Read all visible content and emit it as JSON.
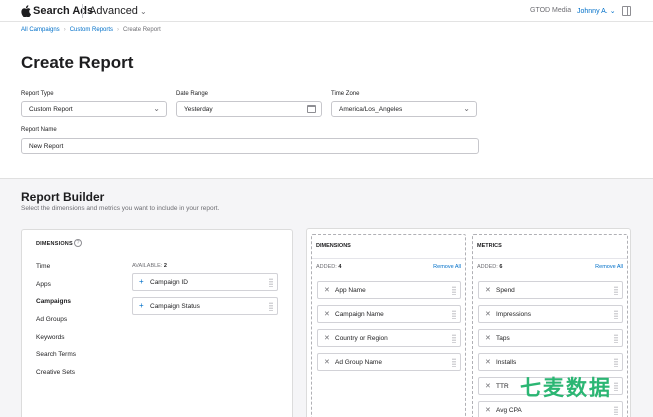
{
  "topbar": {
    "brand": "Search Ads",
    "product": "Advanced",
    "org": "GTOD Media",
    "user": "Johnny A."
  },
  "breadcrumb": [
    "All Campaigns",
    "Custom Reports",
    "Create Report"
  ],
  "page_title": "Create Report",
  "form": {
    "report_type": {
      "label": "Report Type",
      "value": "Custom Report"
    },
    "date_range": {
      "label": "Date Range",
      "value": "Yesterday"
    },
    "time_zone": {
      "label": "Time Zone",
      "value": "America/Los_Angeles"
    },
    "report_name": {
      "label": "Report Name",
      "value": "New Report"
    }
  },
  "builder": {
    "title": "Report Builder",
    "subtitle": "Select the dimensions and metrics you want to include in your report.",
    "dimensions_header": "DIMENSIONS",
    "categories": [
      "Time",
      "Apps",
      "Campaigns",
      "Ad Groups",
      "Keywords",
      "Search Terms",
      "Creative Sets"
    ],
    "active_category": "Campaigns",
    "available_label": "AVAILABLE:",
    "available_count": "2",
    "available": [
      "Campaign ID",
      "Campaign Status"
    ],
    "added_dimensions": {
      "title": "DIMENSIONS",
      "added_label": "ADDED:",
      "count": "4",
      "remove_all": "Remove All",
      "items": [
        "App Name",
        "Campaign Name",
        "Country or Region",
        "Ad Group Name"
      ]
    },
    "added_metrics": {
      "title": "METRICS",
      "added_label": "ADDED:",
      "count": "6",
      "remove_all": "Remove All",
      "items": [
        "Spend",
        "Impressions",
        "Taps",
        "Installs",
        "TTR",
        "Avg CPA"
      ]
    }
  },
  "watermark": "七麦数据",
  "colors": {
    "accent": "#0070c9",
    "watermark": "#2bb673"
  }
}
